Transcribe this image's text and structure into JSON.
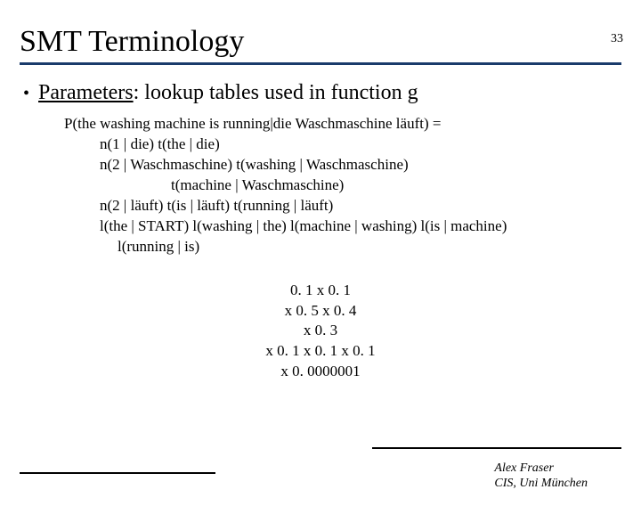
{
  "page_number": "33",
  "title": "SMT Terminology",
  "bullet": {
    "term": "Parameters",
    "rest": ": lookup tables used in function g"
  },
  "formula": {
    "line1": "P(the washing machine is running|die Waschmaschine läuft) =",
    "line2": "n(1 | die) t(the | die)",
    "line3": "n(2 | Waschmaschine)  t(washing | Waschmaschine)",
    "line4": "t(machine | Waschmaschine)",
    "line5": "n(2 | läuft) t(is | läuft) t(running | läuft)",
    "line6": "l(the | START) l(washing | the) l(machine | washing) l(is | machine)",
    "line7": "l(running | is)"
  },
  "numbers": {
    "n1": "0. 1 x 0. 1",
    "n2": "x 0. 5 x 0. 4",
    "n3": "x 0. 3",
    "n4": "x 0. 1 x 0. 1 x 0. 1",
    "n5": "x 0. 0000001"
  },
  "footer": {
    "author": "Alex Fraser",
    "affiliation": "CIS, Uni München"
  }
}
